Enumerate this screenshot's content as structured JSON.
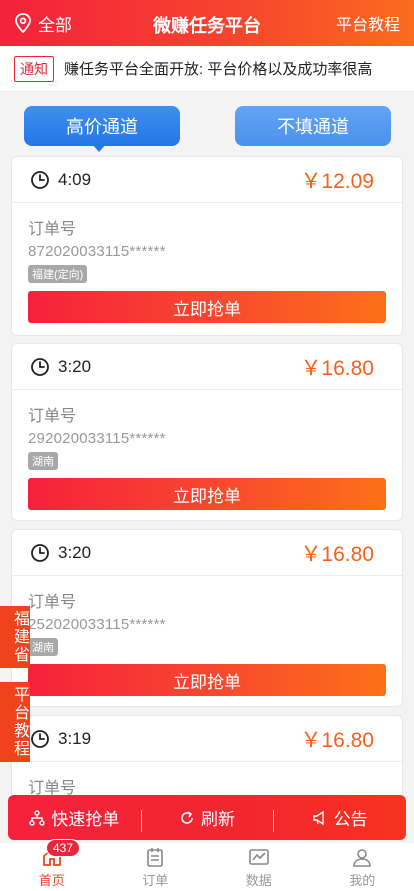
{
  "header": {
    "location": "全部",
    "title": "微赚任务平台",
    "tutorial": "平台教程"
  },
  "notice": {
    "tag": "通知",
    "text": "赚任务平台全面开放: 平台价格以及成功率很高"
  },
  "tabs": {
    "left": "高价通道",
    "right": "不填通道"
  },
  "cards": [
    {
      "time": "4:09",
      "price": "￥12.09",
      "label": "订单号",
      "order": "872020033115******",
      "region": "福建(定向)",
      "button": "立即抢单"
    },
    {
      "time": "3:20",
      "price": "￥16.80",
      "label": "订单号",
      "order": "292020033115******",
      "region": "湖南",
      "button": "立即抢单"
    },
    {
      "time": "3:20",
      "price": "￥16.80",
      "label": "订单号",
      "order": "252020033115******",
      "region": "湖南",
      "button": "立即抢单"
    },
    {
      "time": "3:19",
      "price": "￥16.80",
      "label": "订单号"
    }
  ],
  "side": {
    "province": "福建省",
    "tutorial": "平台教程"
  },
  "actions": {
    "quick": "快速抢单",
    "refresh": "刷新",
    "announce": "公告"
  },
  "nav": {
    "badge": "437",
    "items": [
      {
        "label": "首页",
        "icon": "home-icon"
      },
      {
        "label": "订单",
        "icon": "clipboard-icon"
      },
      {
        "label": "数据",
        "icon": "chart-icon"
      },
      {
        "label": "我的",
        "icon": "user-icon"
      }
    ]
  },
  "colors": {
    "primary": "#f4213b",
    "accent": "#f6611f",
    "blue": "#2477e6"
  }
}
